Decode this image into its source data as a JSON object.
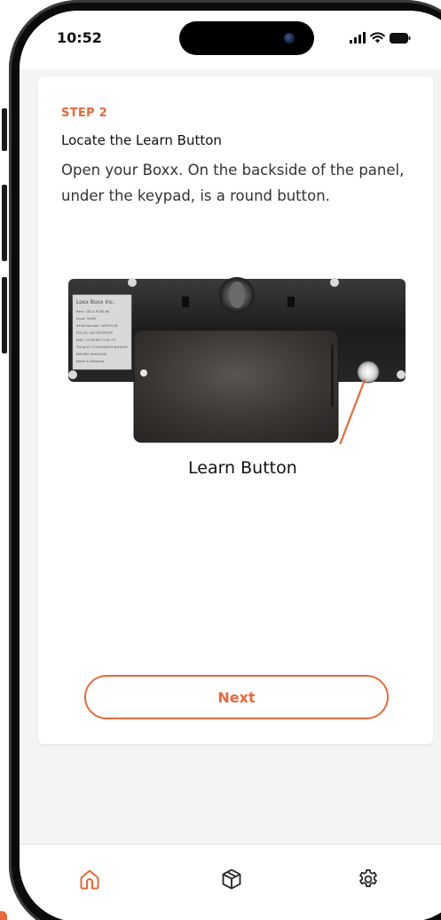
{
  "status_bar": {
    "time": "10:52",
    "icons": [
      "signal-icon",
      "wifi-icon",
      "battery-icon"
    ]
  },
  "step": {
    "label": "STEP 2",
    "title": "Locate the Learn Button",
    "description": "Open your Boxx. On the backside of the panel, under the keypad, is a round button."
  },
  "illustration": {
    "label_sticker": {
      "title": "Loxx Boxx Inc.",
      "lines": [
        "Item: LB2-X PCBA 6K",
        "Input: 3V/6V",
        "Serial Number: LBHY0118",
        "FCC ID: 2AC7ZESP32M",
        "MAC: 1C:69:B0:72:0C:7C",
        "Thing ID: 27u5016d1f2(#####",
        "Wifi-Wifi (Keb2040)",
        "Made in Malaysia"
      ]
    },
    "caption": "Learn Button"
  },
  "actions": {
    "next_label": "Next"
  },
  "tab_bar": {
    "items": [
      {
        "name": "home",
        "icon": "home-icon",
        "active": true
      },
      {
        "name": "boxes",
        "icon": "box-icon",
        "active": false
      },
      {
        "name": "settings",
        "icon": "gear-icon",
        "active": false
      }
    ]
  },
  "colors": {
    "accent": "#e8683a",
    "text": "#111111",
    "background": "#f4f4f4",
    "card": "#ffffff"
  }
}
